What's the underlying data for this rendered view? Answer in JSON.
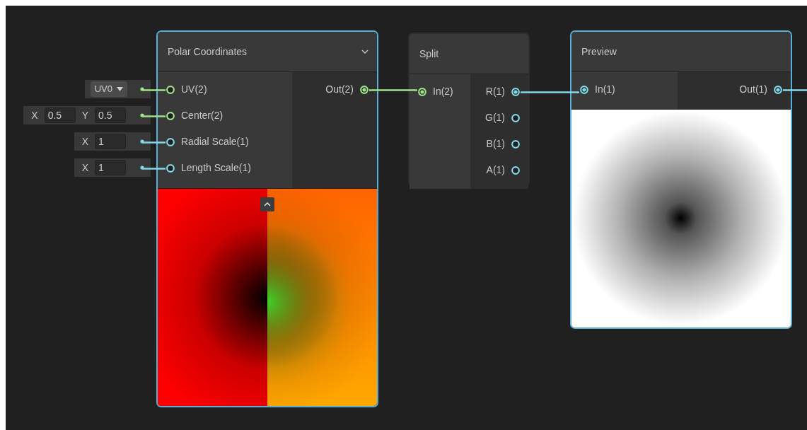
{
  "nodes": [
    {
      "kind": "polar",
      "title": "Polar Coordinates",
      "selected": true,
      "expanded": true,
      "inputs": [
        {
          "label": "UV(2)",
          "color": "#9ee38b",
          "connected": false,
          "default": {
            "kind": "dropdown",
            "value": "UV0"
          }
        },
        {
          "label": "Center(2)",
          "color": "#9ee38b",
          "connected": false,
          "default": {
            "kind": "vector",
            "fields": [
              {
                "axis": "X",
                "value": "0.5"
              },
              {
                "axis": "Y",
                "value": "0.5"
              }
            ]
          }
        },
        {
          "label": "Radial Scale(1)",
          "color": "#84d8e8",
          "connected": false,
          "default": {
            "kind": "vector",
            "fields": [
              {
                "axis": "X",
                "value": "1"
              }
            ]
          }
        },
        {
          "label": "Length Scale(1)",
          "color": "#84d8e8",
          "connected": false,
          "default": {
            "kind": "vector",
            "fields": [
              {
                "axis": "X",
                "value": "1"
              }
            ]
          }
        }
      ],
      "outputs": [
        {
          "label": "Out(2)",
          "color": "#9ee38b",
          "connected": true
        }
      ]
    },
    {
      "kind": "split",
      "title": "Split",
      "selected": false,
      "inputs": [
        {
          "label": "In(2)",
          "color": "#9ee38b",
          "connected": true
        }
      ],
      "outputs": [
        {
          "label": "R(1)",
          "color": "#84d8e8",
          "connected": true
        },
        {
          "label": "G(1)",
          "color": "#84d8e8",
          "connected": false
        },
        {
          "label": "B(1)",
          "color": "#84d8e8",
          "connected": false
        },
        {
          "label": "A(1)",
          "color": "#84d8e8",
          "connected": false
        }
      ]
    },
    {
      "kind": "preview",
      "title": "Preview",
      "selected": true,
      "inputs": [
        {
          "label": "In(1)",
          "color": "#84d8e8",
          "connected": true
        }
      ],
      "outputs": [
        {
          "label": "Out(1)",
          "color": "#84d8e8",
          "connected": true
        }
      ]
    }
  ]
}
